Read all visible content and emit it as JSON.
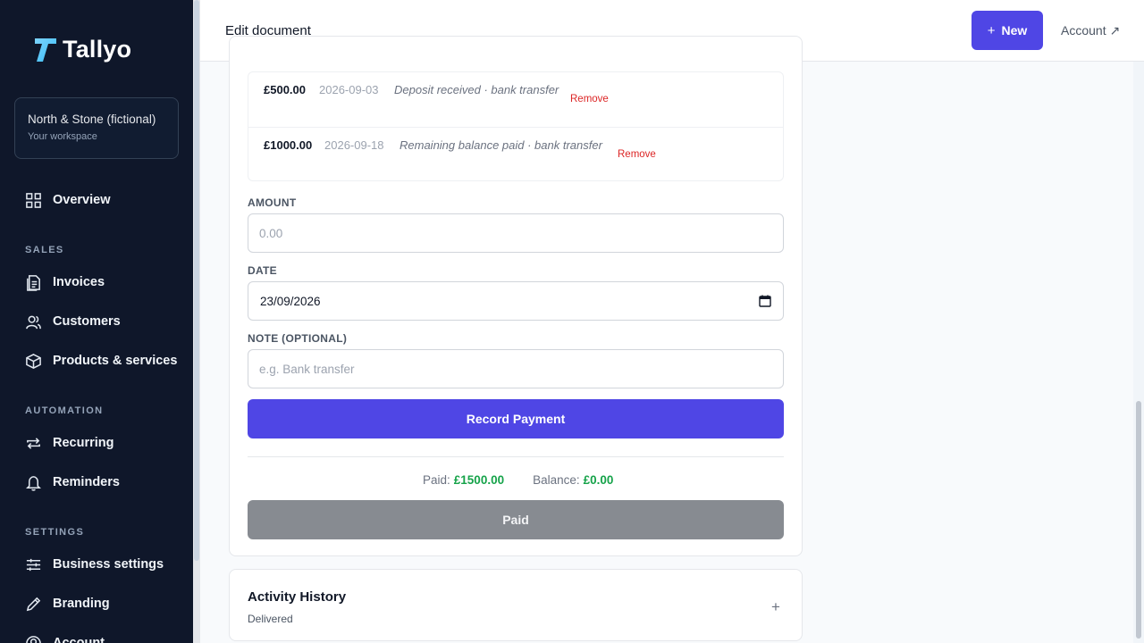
{
  "app": {
    "name": "Tallyo"
  },
  "workspace": {
    "name": "North & Stone (fictional)",
    "subtitle": "Your workspace"
  },
  "sidebar": {
    "overview": "Overview",
    "sections": {
      "sales": "SALES",
      "automation": "AUTOMATION",
      "settings": "SETTINGS"
    },
    "items": {
      "invoices": "Invoices",
      "customers": "Customers",
      "products": "Products & services",
      "recurring": "Recurring",
      "reminders": "Reminders",
      "business_settings": "Business settings",
      "branding": "Branding",
      "account": "Account"
    }
  },
  "header": {
    "title": "Edit document",
    "new_label": "New",
    "account_label": "Account ↗"
  },
  "payments": [
    {
      "amount": "£500.00",
      "date": "2026-09-03",
      "note": "Deposit received · bank transfer",
      "remove": "Remove"
    },
    {
      "amount": "£1000.00",
      "date": "2026-09-18",
      "note": "Remaining balance paid · bank transfer",
      "remove": "Remove"
    }
  ],
  "form": {
    "amount_label": "AMOUNT",
    "amount_placeholder": "0.00",
    "date_label": "DATE",
    "date_value": "23/09/2026",
    "note_label": "NOTE (OPTIONAL)",
    "note_placeholder": "e.g. Bank transfer",
    "record_button": "Record Payment"
  },
  "summary": {
    "paid_label": "Paid:",
    "paid_value": "£1500.00",
    "balance_label": "Balance:",
    "balance_value": "£0.00"
  },
  "status_button": "Paid",
  "activity": {
    "title": "Activity History",
    "subtitle": "Delivered",
    "toggle": "+"
  },
  "colors": {
    "accent": "#4f46e5",
    "sidebar_bg": "#0f172a",
    "success": "#16a34a",
    "danger": "#dc2626"
  }
}
